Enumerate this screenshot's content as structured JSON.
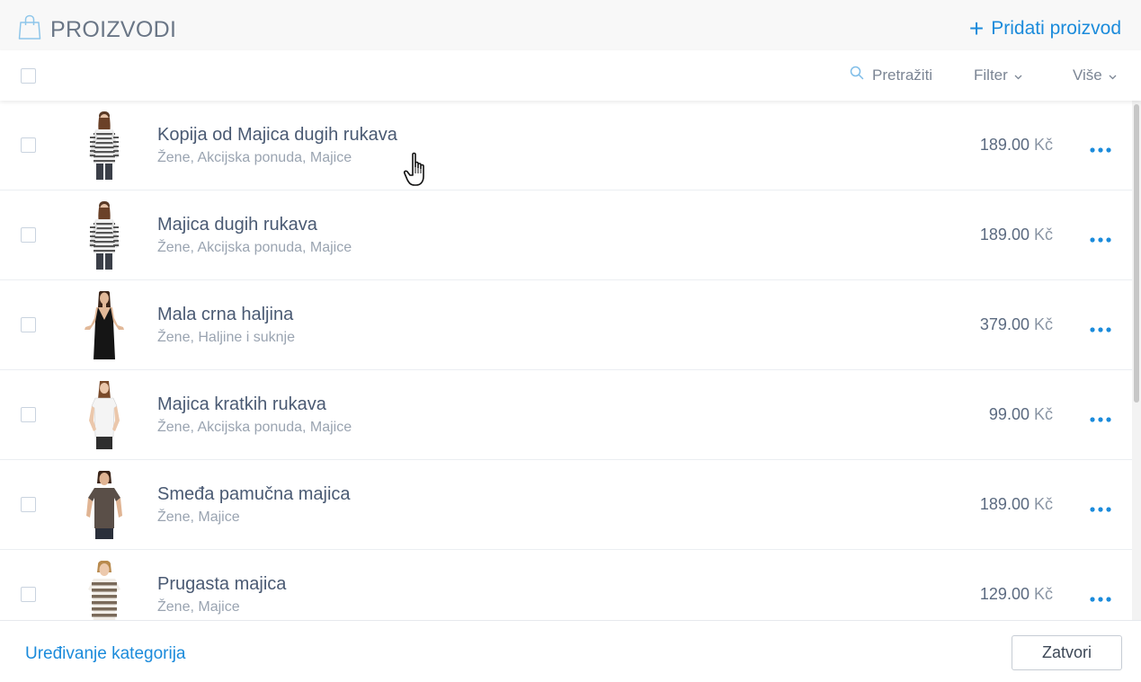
{
  "header": {
    "title": "PROIZVODI",
    "add_label": "Pridati proizvod",
    "add_symbol": "+"
  },
  "toolbar": {
    "search_label": "Pretražiti",
    "filter_label": "Filter",
    "more_label": "Više"
  },
  "products": [
    {
      "name": "Kopija od Majica dugih rukava",
      "categories": "Žene, Akcijska ponuda, Majice",
      "price": "189.00",
      "currency": "Kč",
      "thumb": "striped-long-sleeve"
    },
    {
      "name": "Majica dugih rukava",
      "categories": "Žene, Akcijska ponuda, Majice",
      "price": "189.00",
      "currency": "Kč",
      "thumb": "striped-long-sleeve"
    },
    {
      "name": "Mala crna haljina",
      "categories": "Žene, Haljine i suknje",
      "price": "379.00",
      "currency": "Kč",
      "thumb": "black-dress"
    },
    {
      "name": "Majica kratkih rukava",
      "categories": "Žene, Akcijska ponuda, Majice",
      "price": "99.00",
      "currency": "Kč",
      "thumb": "white-tshirt"
    },
    {
      "name": "Smeđa pamučna majica",
      "categories": "Žene, Majice",
      "price": "189.00",
      "currency": "Kč",
      "thumb": "brown-tshirt"
    },
    {
      "name": "Prugasta majica",
      "categories": "Žene, Majice",
      "price": "129.00",
      "currency": "Kč",
      "thumb": "striped-short-sleeve"
    }
  ],
  "footer": {
    "edit_categories_label": "Uređivanje kategorija",
    "close_label": "Zatvori"
  },
  "colors": {
    "accent": "#1b8bdb",
    "text": "#4a5a73",
    "muted": "#9aa4b1"
  }
}
